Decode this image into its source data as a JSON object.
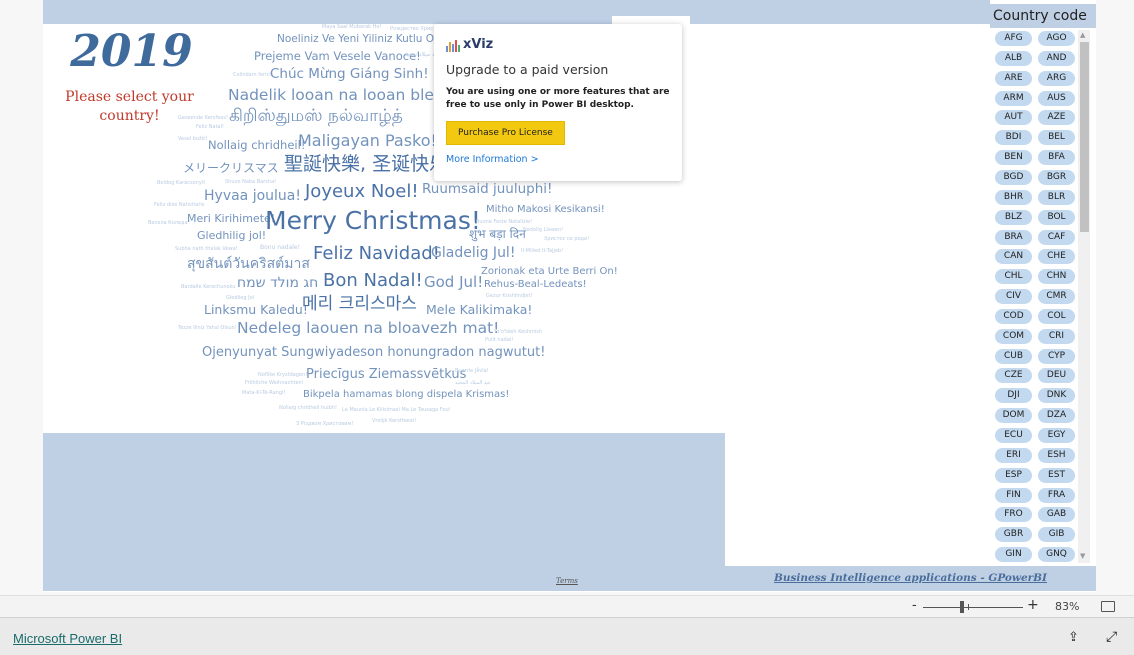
{
  "report": {
    "year": "2019",
    "prompt": "Please select your country!",
    "terms_link": "Terms",
    "credit_link": "Business Intelligence applications - GPowerBI"
  },
  "word_cloud": {
    "colors": {
      "dark": "#4a72a6",
      "mid": "#7393bd",
      "light": "#b9cbe2"
    },
    "words": [
      "Maya Saal Mubarak Ho!",
      "Рождество Христово",
      "Noeliniz Ve Yeni Yiliniz Kutlu Olsun!",
      "Prejeme Vam Vesele Vanoce!",
      "عيد ميلاد سعيد",
      "Colindam fericit",
      "Chúc Mừng Giáng Sinh!",
      "Nadelik looan na looan blethen",
      "கிறிஸ்துமஸ் நல்வாழ்த்",
      "Geseende Kersfees!",
      "Feliz Natal!",
      "Vesel božič!",
      "Nollaig chridheil!",
      "Maligayan Pasko!",
      "メリークリスマス",
      "聖誕快樂, 圣诞快乐",
      "Boldog Karácsonyt!",
      "Shuvo Naba Barsha!",
      "Hyvaa joulua!",
      "Joyeux Noel!",
      "Ruumsaid juuluphi!",
      "Felix dies Nativitatis",
      "Весела Коледа",
      "Meri Kirihimete!",
      "Merry Christmas!",
      "Mitho Makosi Kesikansi!",
      "Buone Feste Natalizie!",
      "शुभ बड़ा दिन",
      "Nadolig Llawen!",
      "Христос се роди!",
      "Gledhilig jol!",
      "Subha nath thalak Vewa!",
      "Bonu nadale!",
      "Feliz Navidad!",
      "Gladelig Jul!",
      "Il-Milied It-Tajjeb!",
      "สุขสันต์วันคริสต์มาส",
      "Zorionak eta Urte Berri On!",
      "Bardalle Kerechunoku",
      "חג מולד שמח",
      "Bon Nadal!",
      "God Jul!",
      "Rehus-Beal-Ledeats!",
      "Gledileg Jol",
      "Gezur Krishlindjet!",
      "Linksmu Kaledu!",
      "메리 크리스마스",
      "Mele Kalikimaka!",
      "Tezze Iliniz Yahsi Olsun!",
      "Nedeleg laouen na bloavezh mat!",
      "Yo'o'tééh Keshmish",
      "Pulit nadal!",
      "Ojenyunyat Sungwiyadeson honungradon nagwutut!",
      "Noflike Krystdagen!",
      "Priecīgus Ziemassvētkus",
      "Buorrie Jåvla!",
      "عيد الميلاد المجيد",
      "Fröhliche Weihnachten!",
      "Mata-Ki-Te-Rangi!",
      "Bikpela hamamas blong dispela Krismas!",
      "Nollaig chridheil huibh!",
      "La Maunia Le Kilisimasi Ma Le Tausaga Fou!",
      "З Різдвом Христовим!",
      "Vrolijk Kerstfeest!"
    ]
  },
  "upsell_popup": {
    "logo": "xViz",
    "title": "Upgrade to a paid version",
    "description": "You are using one or more features that are free to use only in Power BI desktop.",
    "button_label": "Purchase Pro License",
    "more_link": "More Information >",
    "button_color": "#f2c811"
  },
  "slicer": {
    "title": "Country code",
    "codes": [
      "AFG",
      "AGO",
      "ALB",
      "AND",
      "ARE",
      "ARG",
      "ARM",
      "AUS",
      "AUT",
      "AZE",
      "BDI",
      "BEL",
      "BEN",
      "BFA",
      "BGD",
      "BGR",
      "BHR",
      "BLR",
      "BLZ",
      "BOL",
      "BRA",
      "CAF",
      "CAN",
      "CHE",
      "CHL",
      "CHN",
      "CIV",
      "CMR",
      "COD",
      "COL",
      "COM",
      "CRI",
      "CUB",
      "CYP",
      "CZE",
      "DEU",
      "DJI",
      "DNK",
      "DOM",
      "DZA",
      "ECU",
      "EGY",
      "ERI",
      "ESH",
      "ESP",
      "EST",
      "FIN",
      "FRA",
      "FRO",
      "GAB",
      "GBR",
      "GIB",
      "GIN",
      "GNQ"
    ],
    "chip_color": "#c2d9ef"
  },
  "zoom": {
    "minus": "-",
    "plus": "+",
    "level": "83%",
    "level_value": 83
  },
  "footer": {
    "brand_link": "Microsoft Power BI",
    "share_icon": "share-icon",
    "fullscreen_icon": "expand-icon"
  }
}
